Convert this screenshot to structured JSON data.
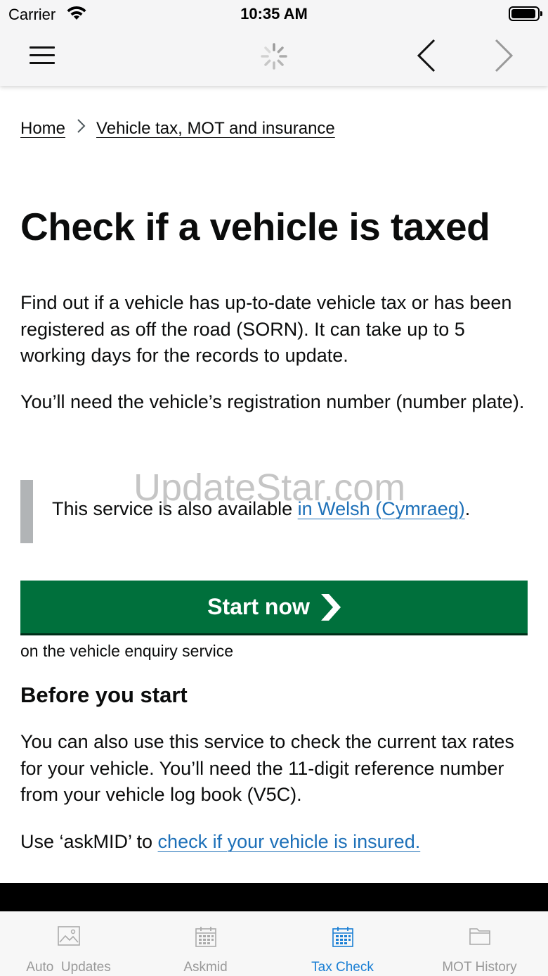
{
  "status_bar": {
    "carrier": "Carrier",
    "time": "10:35 AM"
  },
  "toolbar": {
    "menu_icon": "hamburger-icon",
    "loading_icon": "spinner-icon",
    "back_icon": "chevron-left-icon",
    "forward_icon": "chevron-right-icon"
  },
  "breadcrumb": {
    "home": "Home",
    "section": "Vehicle tax, MOT and insurance"
  },
  "page": {
    "title": "Check if a vehicle is taxed",
    "intro": "Find out if a vehicle has up-to-date vehicle tax or has been registered as off the road (SORN). It can take up to 5 working days for the records to update.",
    "need": "You’ll need the vehicle’s registration number (number plate).",
    "inset_text": "This service is also available ",
    "inset_link": "in Welsh (Cymraeg)",
    "inset_end": ".",
    "start_button": "Start now",
    "start_note": "on the vehicle enquiry service",
    "before_heading": "Before you start",
    "before_text": "You can also use this service to check the current tax rates for your vehicle. You’ll need the 11-digit reference number from your vehicle log book (V5C).",
    "askmid_text": "Use ‘askMID’ to ",
    "askmid_link": "check if your vehicle is insured."
  },
  "watermark": "UpdateStar.com",
  "tabs": [
    {
      "label": "Auto  Updates",
      "icon": "photo-icon",
      "active": false
    },
    {
      "label": "Askmid",
      "icon": "calendar-icon",
      "active": false
    },
    {
      "label": "Tax Check",
      "icon": "calendar-icon",
      "active": true
    },
    {
      "label": "MOT History",
      "icon": "folder-icon",
      "active": false
    }
  ],
  "colors": {
    "govuk_green": "#00703c",
    "link_blue": "#1d70b8",
    "tab_active": "#1a7fd4",
    "inset_bar": "#b1b4b6"
  }
}
